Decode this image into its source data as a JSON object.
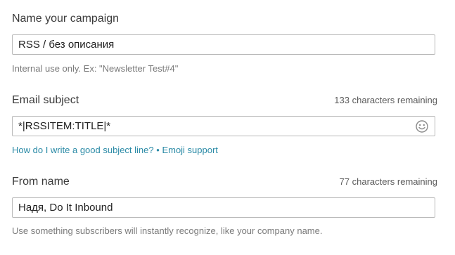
{
  "campaign_name": {
    "label": "Name your campaign",
    "value": "RSS / без описания",
    "help": "Internal use only. Ex: \"Newsletter Test#4\""
  },
  "email_subject": {
    "label": "Email subject",
    "counter": "133 characters remaining",
    "value": "*|RSSITEM:TITLE|*",
    "emoji_icon": "smiley-face-icon",
    "help_link": "How do I write a good subject line?",
    "separator": "•",
    "emoji_link": "Emoji support"
  },
  "from_name": {
    "label": "From name",
    "counter": "77 characters remaining",
    "value": "Надя, Do It Inbound",
    "help": "Use something subscribers will instantly recognize, like your company name."
  }
}
